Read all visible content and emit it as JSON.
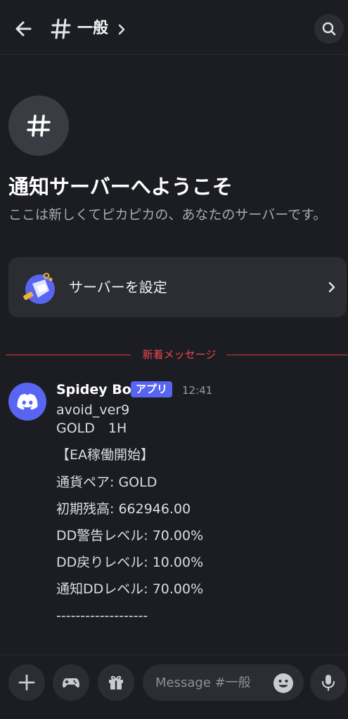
{
  "header": {
    "channel_name": "一般"
  },
  "welcome": {
    "title": "通知サーバーへようこそ",
    "description": "ここは新しくてピカピカの、あなたのサーバーです。",
    "setup_label": "サーバーを設定"
  },
  "divider": {
    "label": "新着メッセージ"
  },
  "message": {
    "author": "Spidey Bot",
    "badge": "アプリ",
    "time": "12:41",
    "lines": [
      "avoid_ver9",
      "GOLD　1H",
      "【EA稼働開始】",
      "通貨ペア: GOLD",
      "初期残高: 662946.00",
      "DD警告レベル: 70.00%",
      "DD戻りレベル: 10.00%",
      "通知DDレベル: 70.00%",
      "-------------------"
    ]
  },
  "composer": {
    "placeholder": "Message #一般"
  },
  "icons": {
    "back": "arrow-left-icon",
    "channel": "hash-icon",
    "chevron": "chevron-right-icon",
    "search": "search-icon",
    "add": "plus-icon",
    "games": "gamepad-icon",
    "gift": "gift-icon",
    "emoji": "emoji-icon",
    "mic": "microphone-icon",
    "avatar": "discord-logo-icon"
  },
  "colors": {
    "background": "#1c1d22",
    "surface": "#2b2d33",
    "accent": "#5865f2",
    "new_messages": "#f0474f"
  }
}
